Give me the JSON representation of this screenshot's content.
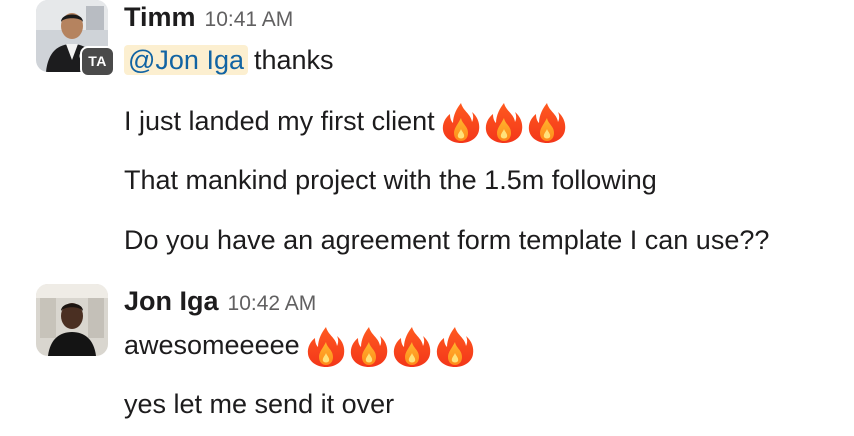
{
  "messages": [
    {
      "sender": "Timm",
      "time": "10:41 AM",
      "badge": "TA",
      "lines": [
        {
          "mention": "@Jon Iga",
          "text": "thanks"
        },
        {
          "text": "I just landed my first client",
          "emoji": [
            "fire",
            "fire",
            "fire"
          ]
        },
        {
          "text": "That mankind project with the 1.5m following"
        },
        {
          "text": "Do you have an agreement form template I can use??"
        }
      ]
    },
    {
      "sender": "Jon Iga",
      "time": "10:42 AM",
      "lines": [
        {
          "text": "awesomeeeee",
          "emoji": [
            "fire",
            "fire",
            "fire",
            "fire"
          ]
        },
        {
          "text": "yes let me send it over"
        }
      ]
    }
  ],
  "colors": {
    "mention_bg": "#fcefd0",
    "mention_text": "#1264a3",
    "timestamp": "#616061",
    "badge_bg": "#4a4a4a"
  }
}
